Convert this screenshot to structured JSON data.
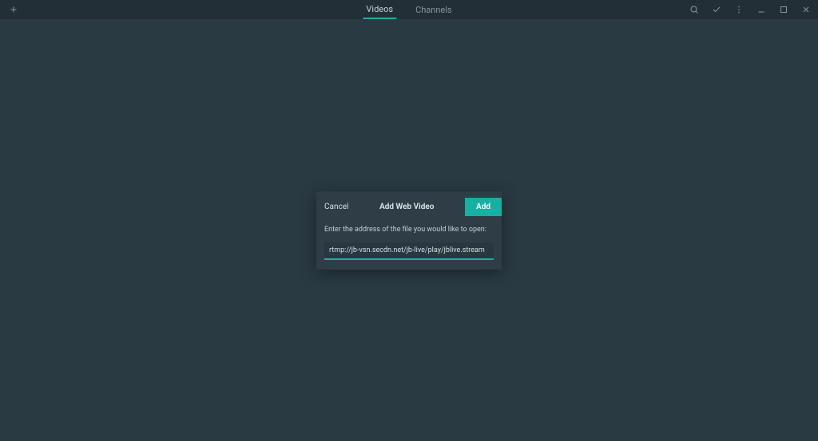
{
  "topbar": {
    "tabs": [
      {
        "label": "Videos",
        "active": true
      },
      {
        "label": "Channels",
        "active": false
      }
    ]
  },
  "modal": {
    "cancel_label": "Cancel",
    "title": "Add Web Video",
    "add_label": "Add",
    "prompt": "Enter the address of the file you would like to open:",
    "input_value": "rtmp://jb-vsn.secdn.net/jb-live/play/jblive.stream"
  }
}
